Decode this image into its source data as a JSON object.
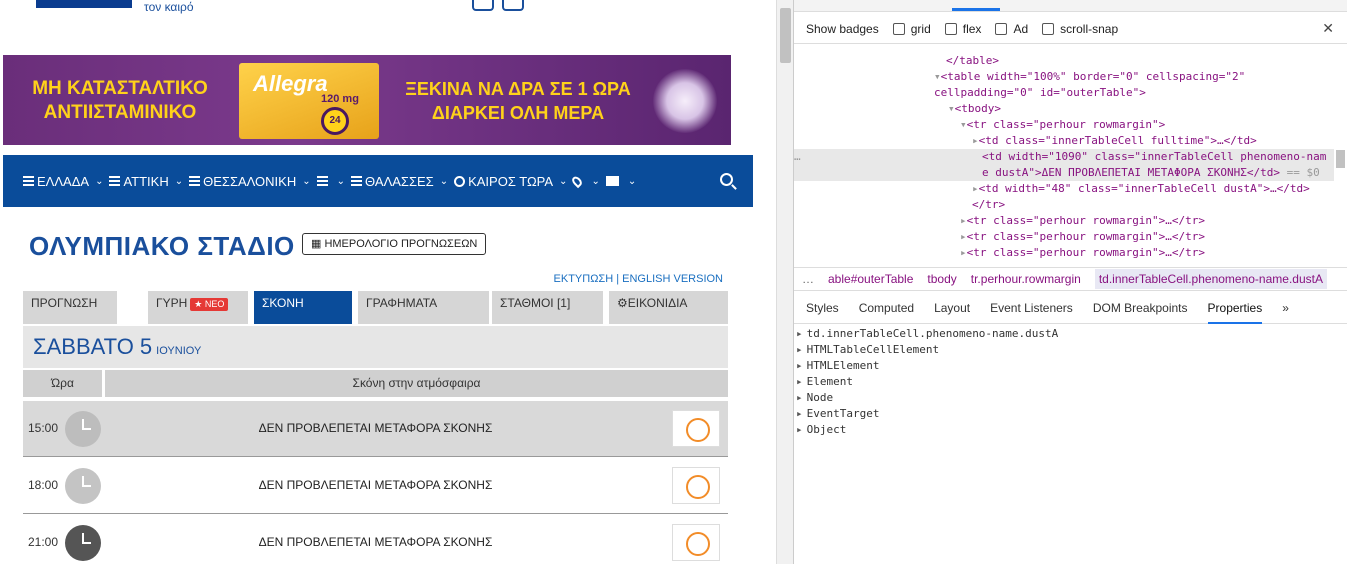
{
  "site": {
    "logo_tagline": "τον καιρό",
    "banner": {
      "left_line1": "ΜΗ ΚΑΤΑΣΤΑΛΤΙΚΟ",
      "left_line2": "ΑΝΤΙΙΣΤΑΜΙΝΙΚΟ",
      "brand": "Allegra",
      "dose": "120 mg",
      "badge": "24",
      "right_line1": "ΞΕΚΙΝΑ ΝΑ ΔΡΑ ΣΕ 1 ΩΡΑ",
      "right_line2": "ΔΙΑΡΚΕΙ ΟΛΗ ΜΕΡΑ"
    },
    "nav": [
      {
        "label": "ΕΛΛΑΔΑ"
      },
      {
        "label": "ΑΤΤΙΚΗ"
      },
      {
        "label": "ΘΕΣΣΑΛΟΝΙΚΗ"
      },
      {
        "label": ""
      },
      {
        "label": "ΘΑΛΑΣΣΕΣ"
      },
      {
        "label": "ΚΑΙΡΟΣ ΤΩΡΑ"
      },
      {
        "label": ""
      },
      {
        "label": ""
      }
    ],
    "page_title": "ΟΛΥΜΠΙΑΚΟ ΣΤΑΔΙΟ",
    "calendar_button": "ΗΜΕΡΟΛΟΓΙΟ ΠΡΟΓΝΩΣΕΩΝ",
    "print_links": "ΕΚΤΥΠΩΣΗ | ENGLISH VERSION",
    "tabs": [
      {
        "label": "ΠΡΟΓΝΩΣΗ"
      },
      {
        "label": "ΓΥΡΗ",
        "badge": "ΝΕΟ"
      },
      {
        "label": "ΣΚΟΝΗ"
      },
      {
        "label": "ΓΡΑΦΗΜΑΤΑ"
      },
      {
        "label": "ΣΤΑΘΜΟΙ [1]"
      },
      {
        "label": "ΕΙΚΟΝΙΔΙΑ"
      }
    ],
    "day": "ΣΑΒΒΑΤΟ 5",
    "month": "ΙΟΥΝΙΟΥ",
    "table_headers": {
      "time": "Ώρα",
      "dust": "Σκόνη στην ατμόσφαιρα"
    },
    "rows": [
      {
        "time": "15:00",
        "text": "ΔΕΝ ΠΡΟΒΛΕΠΕΤΑΙ ΜΕΤΑΦΟΡΑ ΣΚΟΝΗΣ"
      },
      {
        "time": "18:00",
        "text": "ΔΕΝ ΠΡΟΒΛΕΠΕΤΑΙ ΜΕΤΑΦΟΡΑ ΣΚΟΝΗΣ"
      },
      {
        "time": "21:00",
        "text": "ΔΕΝ ΠΡΟΒΛΕΠΕΤΑΙ ΜΕΤΑΦΟΡΑ ΣΚΟΝΗΣ"
      }
    ]
  },
  "devtools": {
    "badges_label": "Show badges",
    "badge_options": [
      "grid",
      "flex",
      "Ad",
      "scroll-snap"
    ],
    "code": {
      "l1": "</table>",
      "l2a": "<table width=\"100%\" border=\"0\" cellspacing=\"2\"",
      "l2b": "cellpadding=\"0\" id=\"outerTable\">",
      "l3": "<tbody>",
      "l4": "<tr class=\"perhour rowmargin\">",
      "l5": "<td class=\"innerTableCell fulltime\">…</td>",
      "l6a": "<td width=\"1090\" class=\"innerTableCell phenomeno-nam",
      "l6b": "e dustA\">ΔΕΝ ΠΡΟΒΛΕΠΕΤΑΙ ΜΕΤΑΦΟΡΑ ΣΚΟΝΗΣ</td>",
      "l6c": " == $0",
      "l7": "<td width=\"48\" class=\"innerTableCell dustA\">…</td>",
      "l8": "</tr>",
      "l9": "<tr class=\"perhour rowmargin\">…</tr>",
      "l10": "<tr class=\"perhour rowmargin\">…</tr>",
      "l11": "<tr class=\"perhour rowmargin\">…</tr>"
    },
    "breadcrumbs": [
      "…",
      "able#outerTable",
      "tbody",
      "tr.perhour.rowmargin",
      "td.innerTableCell.phenomeno-name.dustA"
    ],
    "panel_tabs": [
      "Styles",
      "Computed",
      "Layout",
      "Event Listeners",
      "DOM Breakpoints",
      "Properties",
      "»"
    ],
    "properties": [
      "td.innerTableCell.phenomeno-name.dustA",
      "HTMLTableCellElement",
      "HTMLElement",
      "Element",
      "Node",
      "EventTarget",
      "Object"
    ]
  }
}
